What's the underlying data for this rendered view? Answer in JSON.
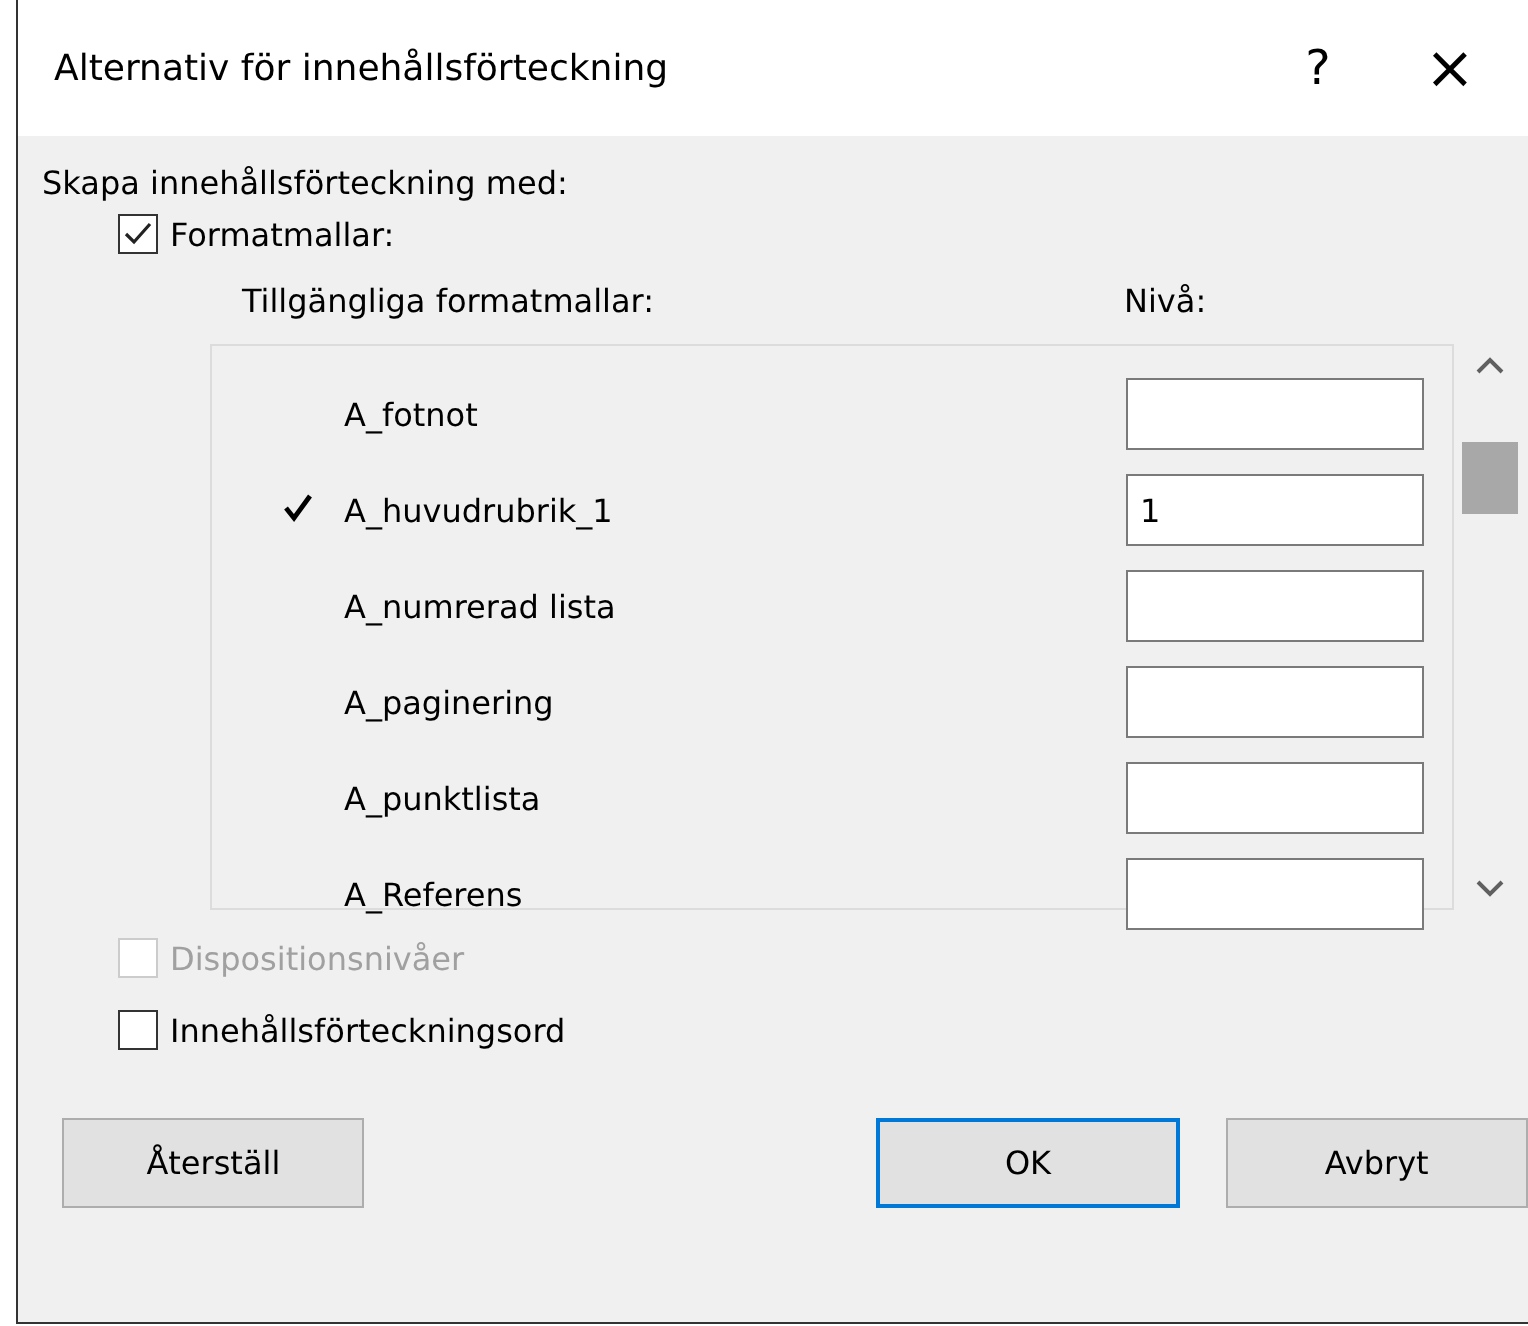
{
  "window": {
    "title": "Alternativ för innehållsförteckning",
    "help": "?",
    "close": "×"
  },
  "section_label": "Skapa innehållsförteckning med:",
  "styles_option": {
    "label": "Formatmallar:",
    "checked": true,
    "disabled": false
  },
  "list": {
    "styles_header": "Tillgängliga formatmallar:",
    "level_header": "Nivå:",
    "rows": [
      {
        "name": "A_fotnot",
        "used": false,
        "level": ""
      },
      {
        "name": "A_huvudrubrik_1",
        "used": true,
        "level": "1"
      },
      {
        "name": "A_numrerad lista",
        "used": false,
        "level": ""
      },
      {
        "name": "A_paginering",
        "used": false,
        "level": ""
      },
      {
        "name": "A_punktlista",
        "used": false,
        "level": ""
      },
      {
        "name": "A_Referens",
        "used": false,
        "level": ""
      }
    ]
  },
  "options": [
    {
      "label": "Dispositionsnivåer",
      "checked": false,
      "disabled": true
    },
    {
      "label": "Innehållsförteckningsord",
      "checked": false,
      "disabled": false
    }
  ],
  "buttons": [
    {
      "label": "Återställ",
      "default": false
    },
    {
      "label": "OK",
      "default": true
    },
    {
      "label": "Avbryt",
      "default": false
    }
  ]
}
